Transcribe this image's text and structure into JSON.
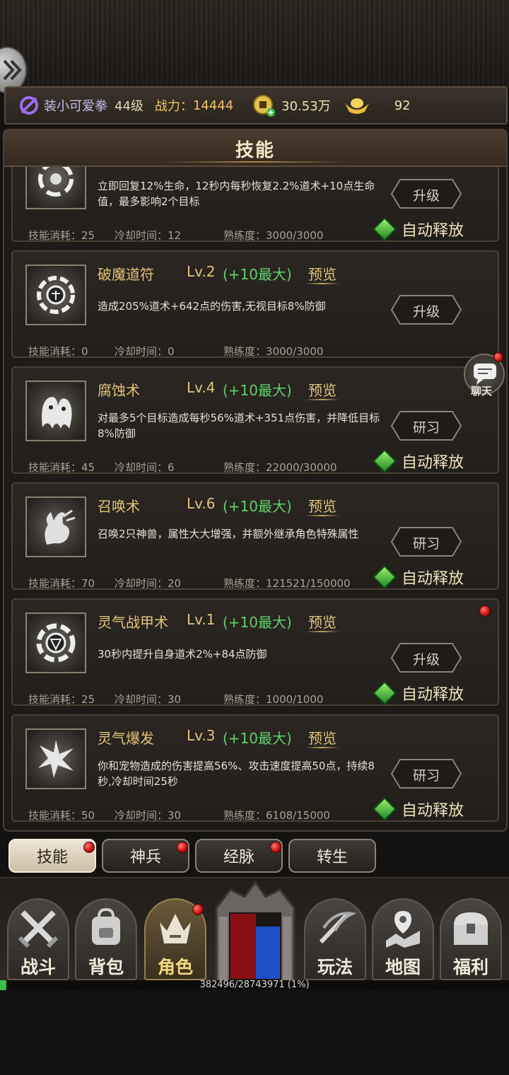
{
  "player": {
    "name": "装小可爱拳",
    "level": "44级",
    "power_label": "战力：",
    "power": "14444",
    "coins": "30.53万",
    "ingots": "92"
  },
  "panel": {
    "title": "技能"
  },
  "skills": [
    {
      "name": "",
      "level": "",
      "max": "",
      "preview": "",
      "desc": "立即回复12%生命，12秒内每秒恢复2.2%道术+10点生命值，最多影响2个目标",
      "cost": "技能消耗：25",
      "cooldown": "冷却时间：12",
      "proficiency": "熟练度：3000/3000",
      "button": "升级",
      "auto": "自动释放"
    },
    {
      "name": "破魔道符",
      "level": "Lv.2",
      "max": "(+10最大)",
      "preview": "预览",
      "desc": "造成205%道术+642点的伤害,无视目标8%防御",
      "cost": "技能消耗：0",
      "cooldown": "冷却时间：0",
      "proficiency": "熟练度：3000/3000",
      "button": "升级",
      "auto": ""
    },
    {
      "name": "腐蚀术",
      "level": "Lv.4",
      "max": "(+10最大)",
      "preview": "预览",
      "desc": "对最多5个目标造成每秒56%道术+351点伤害，并降低目标8%防御",
      "cost": "技能消耗：45",
      "cooldown": "冷却时间：6",
      "proficiency": "熟练度：22000/30000",
      "button": "研习",
      "auto": "自动释放"
    },
    {
      "name": "召唤术",
      "level": "Lv.6",
      "max": "(+10最大)",
      "preview": "预览",
      "desc": "召唤2只神兽，属性大大增强，并额外继承角色特殊属性",
      "cost": "技能消耗：70",
      "cooldown": "冷却时间：20",
      "proficiency": "熟练度：121521/150000",
      "button": "研习",
      "auto": "自动释放"
    },
    {
      "name": "灵气战甲术",
      "level": "Lv.1",
      "max": "(+10最大)",
      "preview": "预览",
      "desc": "30秒内提升自身道术2%+84点防御",
      "cost": "技能消耗：25",
      "cooldown": "冷却时间：30",
      "proficiency": "熟练度：1000/1000",
      "button": "升级",
      "auto": "自动释放"
    },
    {
      "name": "灵气爆发",
      "level": "Lv.3",
      "max": "(+10最大)",
      "preview": "预览",
      "desc": "你和宠物造成的伤害提高56%、攻击速度提高50点，持续8秒,冷却时间25秒",
      "cost": "技能消耗：50",
      "cooldown": "冷却时间：30",
      "proficiency": "熟练度：6108/15000",
      "button": "研习",
      "auto": "自动释放"
    }
  ],
  "chat": {
    "label": "聊天"
  },
  "subtabs": [
    "技能",
    "神兵",
    "经脉",
    "转生"
  ],
  "nav": [
    "战斗",
    "背包",
    "角色",
    "玩法",
    "地图",
    "福利"
  ],
  "exp": {
    "text": "382496/28743971 (1%)",
    "fraction": 0.013
  },
  "colors": {
    "accent_gold": "#e3c47c",
    "max_green": "#5fd06b",
    "exp_green": "#3cbf48"
  }
}
